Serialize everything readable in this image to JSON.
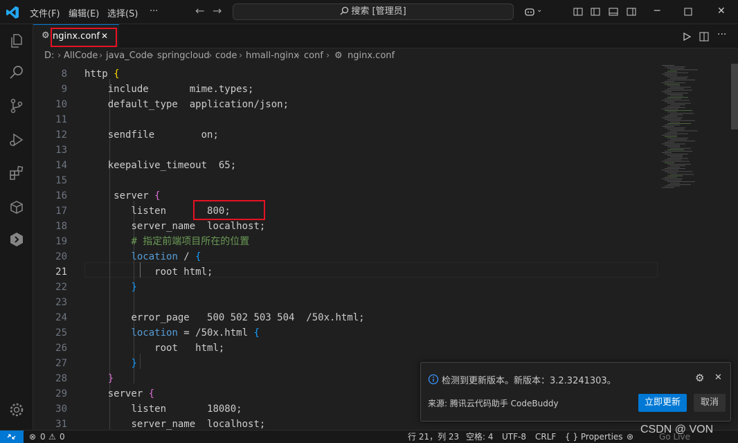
{
  "menu": {
    "file": "文件(F)",
    "edit": "编辑(E)",
    "selection": "选择(S)",
    "more": "···"
  },
  "search": {
    "placeholder": "搜索 [管理员]"
  },
  "tab": {
    "label": "nginx.conf",
    "close": "✕"
  },
  "breadcrumb": [
    "D:",
    "AllCode",
    "java_Code",
    "springcloud",
    "code",
    "hmall-nginx",
    "conf",
    "nginx.conf"
  ],
  "code": [
    {
      "n": "8",
      "text": "http {"
    },
    {
      "n": "9",
      "text": "    include       mime.types;"
    },
    {
      "n": "10",
      "text": "    default_type  application/json;"
    },
    {
      "n": "11",
      "text": ""
    },
    {
      "n": "12",
      "text": "    sendfile        on;"
    },
    {
      "n": "13",
      "text": ""
    },
    {
      "n": "14",
      "text": "    keepalive_timeout  65;"
    },
    {
      "n": "15",
      "text": ""
    },
    {
      "n": "16",
      "text": "     server {"
    },
    {
      "n": "17",
      "text": "        listen       800;"
    },
    {
      "n": "18",
      "text": "        server_name  localhost;"
    },
    {
      "n": "19",
      "text": "        # 指定前端项目所在的位置"
    },
    {
      "n": "20",
      "text": "        location / {"
    },
    {
      "n": "21",
      "text": "            root html;"
    },
    {
      "n": "22",
      "text": "        }"
    },
    {
      "n": "23",
      "text": ""
    },
    {
      "n": "24",
      "text": "        error_page   500 502 503 504  /50x.html;"
    },
    {
      "n": "25",
      "text": "        location = /50x.html {"
    },
    {
      "n": "26",
      "text": "            root   html;"
    },
    {
      "n": "27",
      "text": "        }"
    },
    {
      "n": "28",
      "text": "    }"
    },
    {
      "n": "29",
      "text": "    server {"
    },
    {
      "n": "30",
      "text": "        listen       18080;"
    },
    {
      "n": "31",
      "text": "        server_name  localhost;"
    }
  ],
  "active_line": "21",
  "notification": {
    "message": "检测到更新版本。新版本：3.2.3241303。",
    "source": "来源: 腾讯云代码助手 CodeBuddy",
    "primary": "立即更新",
    "secondary": "取消"
  },
  "status": {
    "errors": "0",
    "warnings": "0",
    "position": "行 21，列 23",
    "indent": "空格: 4",
    "encoding": "UTF-8",
    "eol": "CRLF",
    "language": "{ } Properties",
    "golive": "Go Live"
  },
  "watermark": "CSDN @ VON",
  "colors": {
    "accent": "#0078d4",
    "highlight_box": "#e81123",
    "keyword": "#569cd6",
    "comment": "#6a9955",
    "bracket_gold": "#ffd700",
    "bracket_purple": "#da70d6",
    "bracket_blue": "#179fff"
  }
}
